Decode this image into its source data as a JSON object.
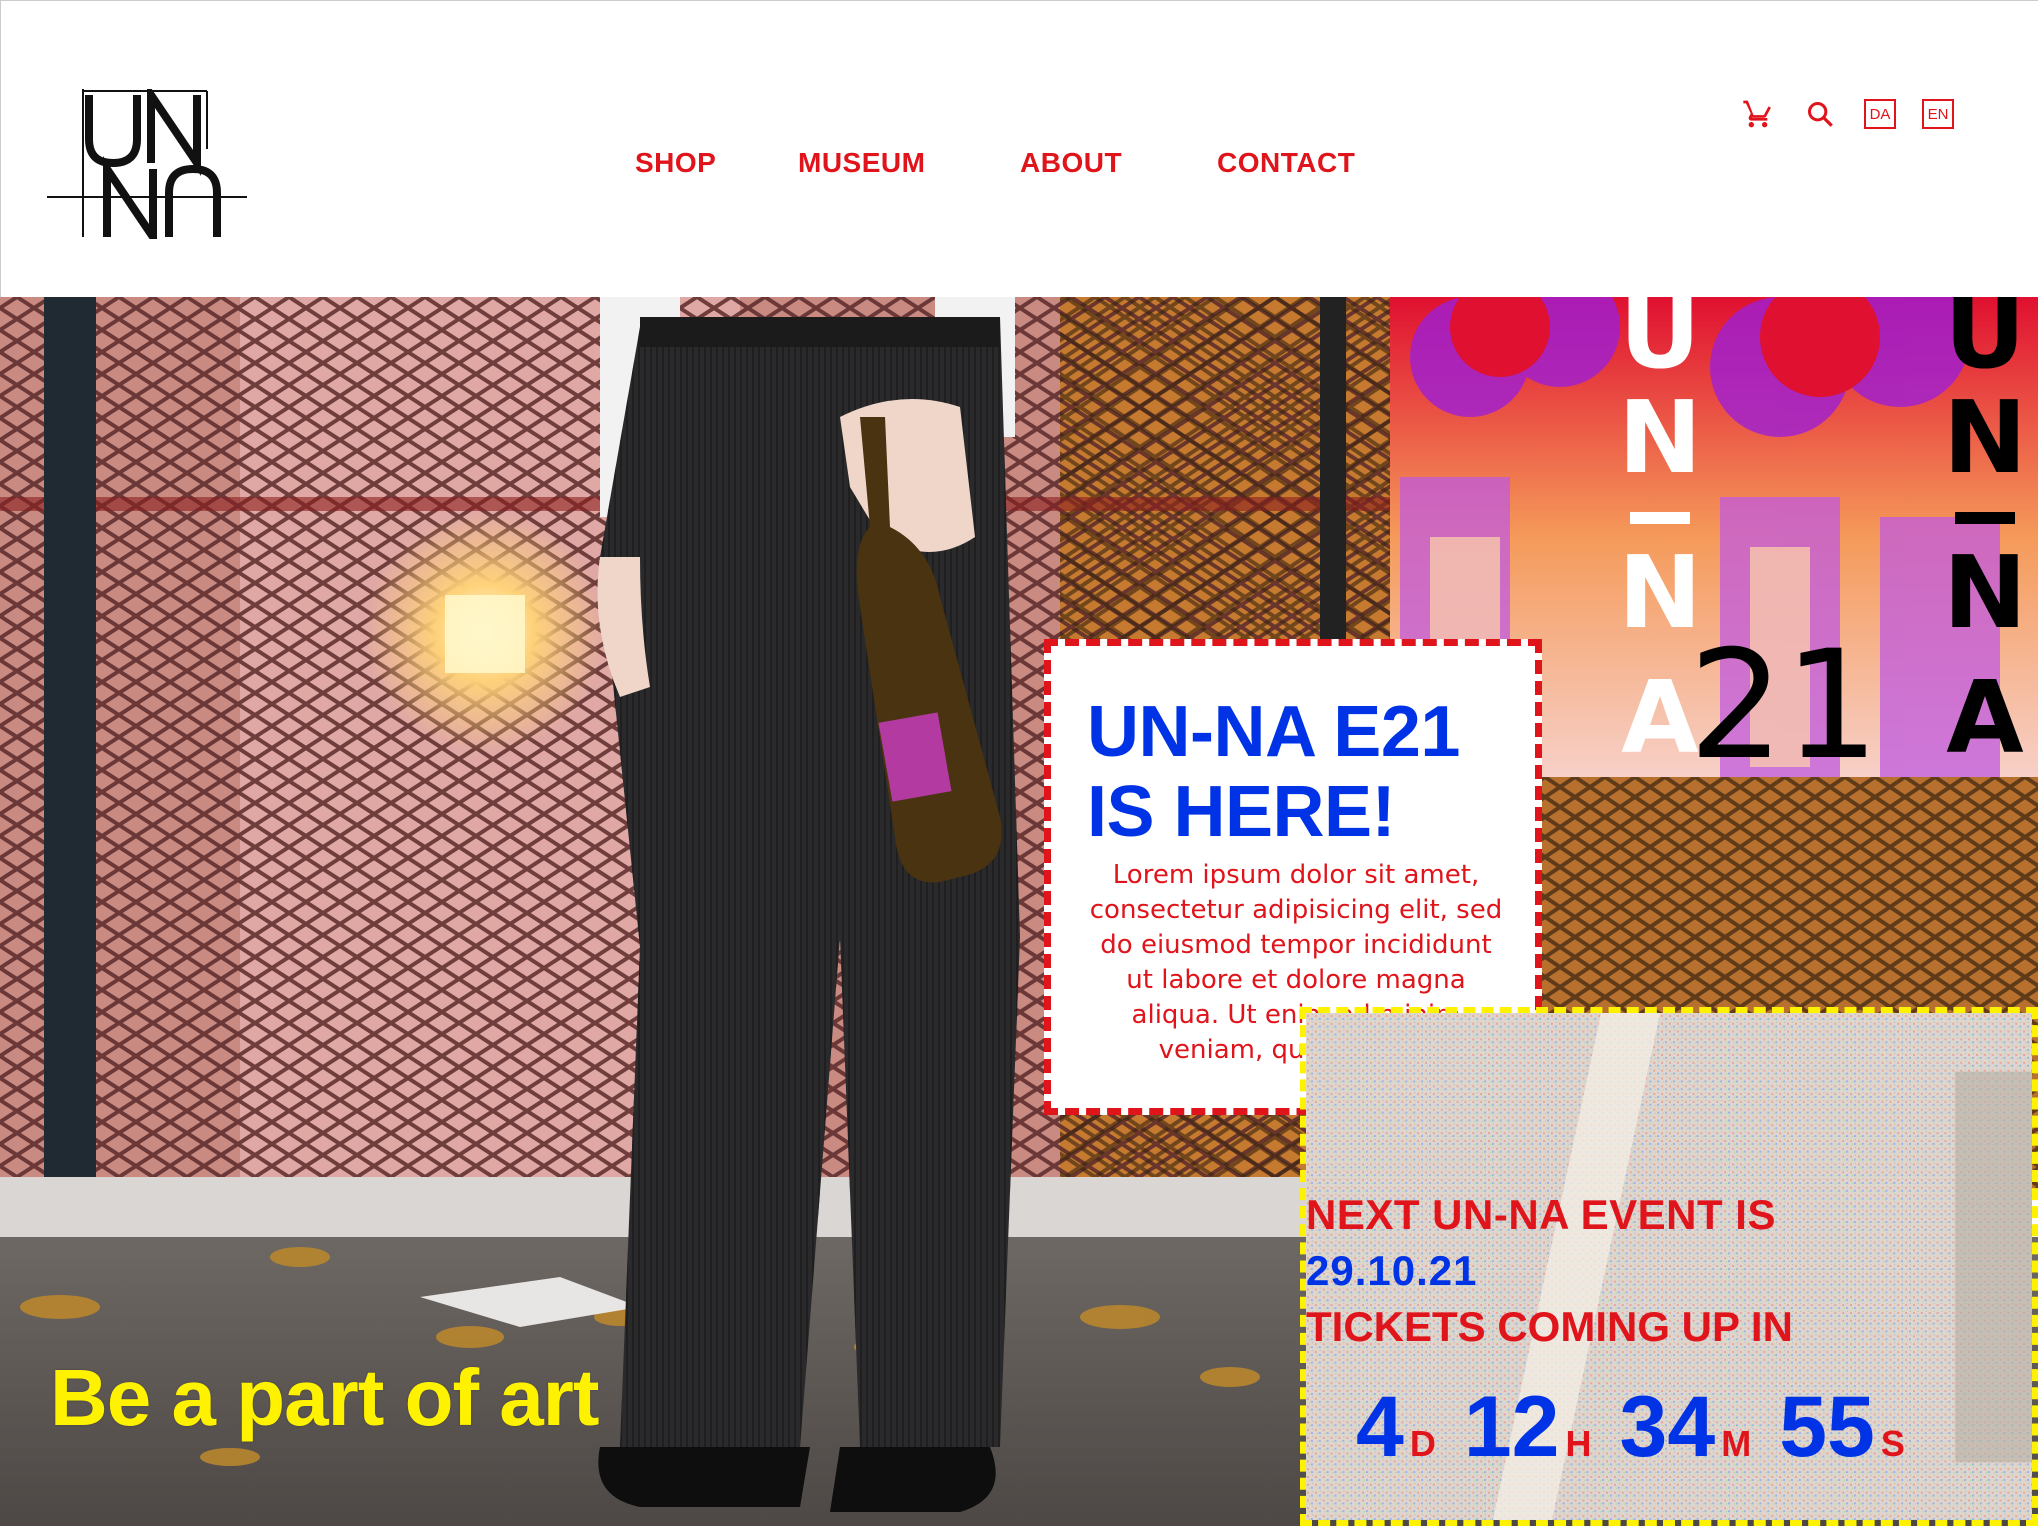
{
  "nav": {
    "items": [
      {
        "label": "SHOP"
      },
      {
        "label": "MUSEUM"
      },
      {
        "label": "ABOUT"
      },
      {
        "label": "CONTACT"
      }
    ]
  },
  "languages": [
    "DA",
    "EN"
  ],
  "icons": {
    "cart": "cart-icon",
    "search": "search-icon"
  },
  "hero": {
    "tagline": "Be a part of art",
    "poster_text": {
      "left_vertical": "UN–NA",
      "number": "21",
      "right_vertical": "UN–NA"
    }
  },
  "release": {
    "title_line1": "UN-NA E21",
    "title_line2": "IS HERE!",
    "body": "Lorem ipsum dolor sit amet, consectetur adipisicing elit, sed do eiusmod tempor incididunt ut labore et dolore magna aliqua. Ut enim ad minim veniam, quis nostrud"
  },
  "event": {
    "next_label": "NEXT UN-NA EVENT IS",
    "date": "29.10.21",
    "tickets_label": "TICKETS COMING UP IN",
    "countdown": [
      {
        "value": "4",
        "unit": "D"
      },
      {
        "value": "12",
        "unit": "H"
      },
      {
        "value": "34",
        "unit": "M"
      },
      {
        "value": "55",
        "unit": "S"
      }
    ]
  },
  "colors": {
    "red": "#e0141b",
    "blue": "#0033e6",
    "yellow": "#fff200"
  }
}
